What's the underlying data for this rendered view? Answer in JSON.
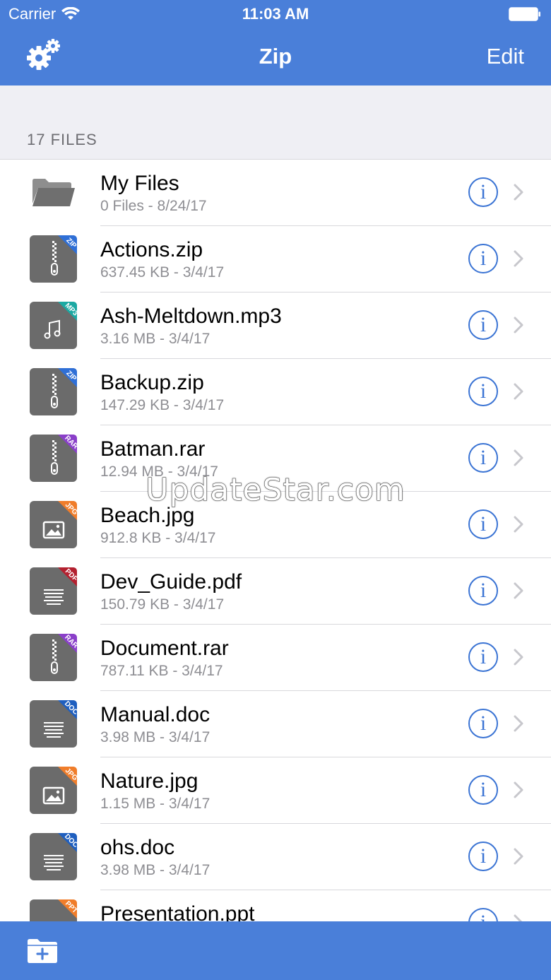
{
  "status_bar": {
    "carrier": "Carrier",
    "time": "11:03 AM"
  },
  "nav": {
    "title": "Zip",
    "edit_label": "Edit",
    "left_icon": "gear-icon"
  },
  "section": {
    "label": "17 FILES"
  },
  "files": [
    {
      "name": "My Files",
      "meta": "0 Files - 8/24/17",
      "kind": "folder",
      "badge": "",
      "badge_color": ""
    },
    {
      "name": "Actions.zip",
      "meta": "637.45 KB - 3/4/17",
      "kind": "zip",
      "badge": "ZIP",
      "badge_color": "#2f6fd6"
    },
    {
      "name": "Ash-Meltdown.mp3",
      "meta": "3.16 MB - 3/4/17",
      "kind": "music",
      "badge": "MP3",
      "badge_color": "#1ba9a3"
    },
    {
      "name": "Backup.zip",
      "meta": "147.29 KB - 3/4/17",
      "kind": "zip",
      "badge": "ZIP",
      "badge_color": "#2f6fd6"
    },
    {
      "name": "Batman.rar",
      "meta": "12.94 MB - 3/4/17",
      "kind": "zip",
      "badge": "RAR",
      "badge_color": "#8a3fc9"
    },
    {
      "name": "Beach.jpg",
      "meta": "912.8 KB - 3/4/17",
      "kind": "image",
      "badge": "JPG",
      "badge_color": "#f07d2a"
    },
    {
      "name": "Dev_Guide.pdf",
      "meta": "150.79 KB - 3/4/17",
      "kind": "doc",
      "badge": "PDF",
      "badge_color": "#b3202f"
    },
    {
      "name": "Document.rar",
      "meta": "787.11 KB - 3/4/17",
      "kind": "zip",
      "badge": "RAR",
      "badge_color": "#8a3fc9"
    },
    {
      "name": "Manual.doc",
      "meta": "3.98 MB - 3/4/17",
      "kind": "doc",
      "badge": "DOC",
      "badge_color": "#1f5fbf"
    },
    {
      "name": "Nature.jpg",
      "meta": "1.15 MB - 3/4/17",
      "kind": "image",
      "badge": "JPG",
      "badge_color": "#f07d2a"
    },
    {
      "name": "ohs.doc",
      "meta": "3.98 MB - 3/4/17",
      "kind": "doc",
      "badge": "DOC",
      "badge_color": "#1f5fbf"
    },
    {
      "name": "Presentation.ppt",
      "meta": "",
      "kind": "doc",
      "badge": "PPT",
      "badge_color": "#f07d2a"
    }
  ],
  "row_action": {
    "info_glyph": "i",
    "info_icon": "info-circle-icon",
    "chevron_icon": "chevron-right-icon"
  },
  "watermark": "UpdateStar.com",
  "toolbar": {
    "new_folder_icon": "new-folder-icon"
  },
  "colors": {
    "bar_blue": "#4a7fd9",
    "info_blue": "#3b74d4",
    "thumb_gray": "#6b6b6b"
  }
}
